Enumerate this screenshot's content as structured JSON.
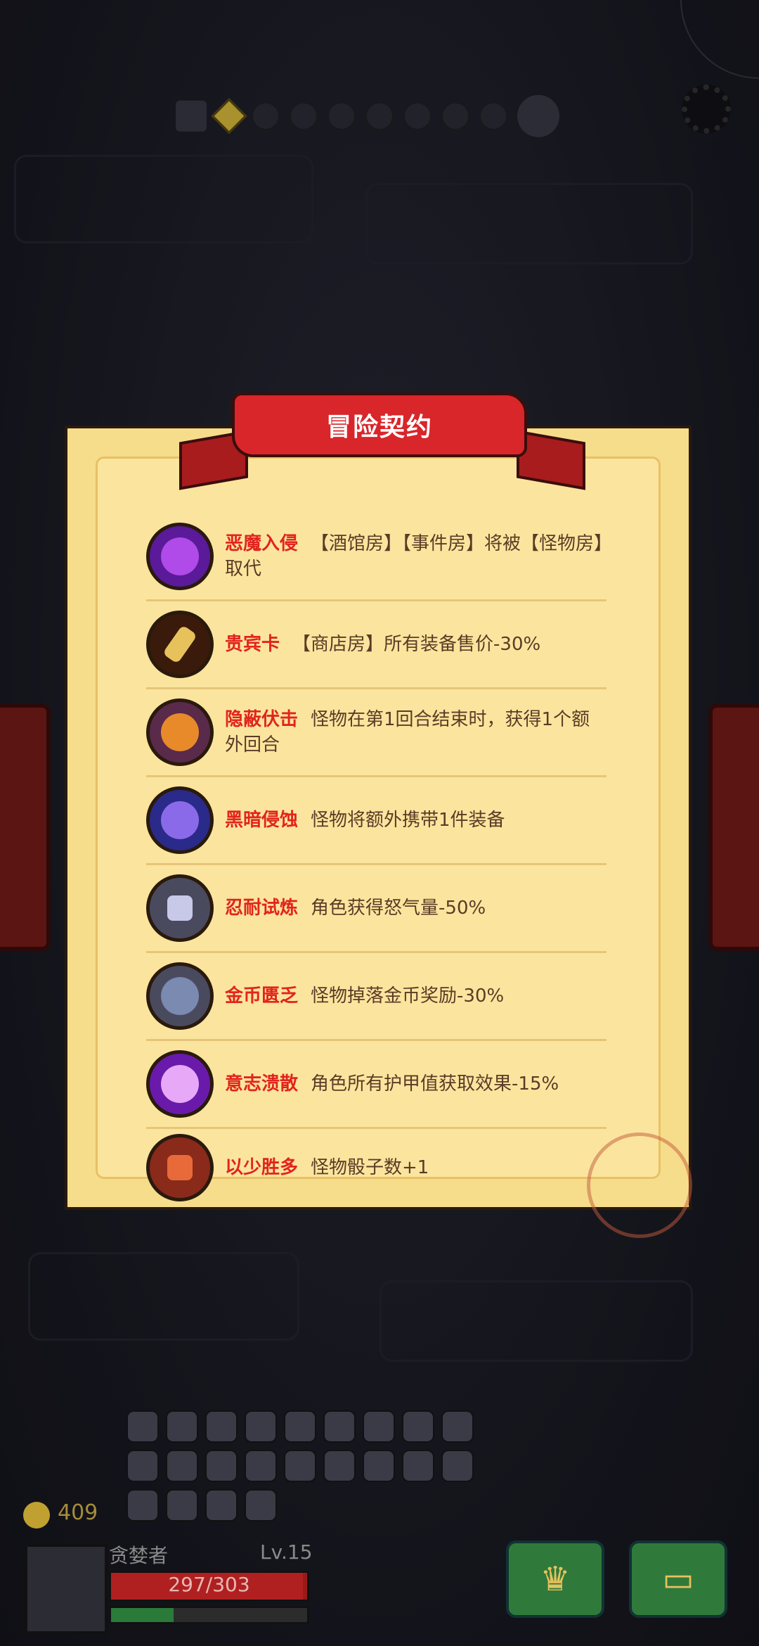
{
  "header": {
    "progress_steps": 9,
    "current_step": 1
  },
  "modal": {
    "title": "冒险契约",
    "contracts": [
      {
        "name": "恶魔入侵",
        "desc": "【酒馆房】【事件房】将被【怪物房】取代",
        "icon": "demon-icon",
        "color": "#7b2ed4"
      },
      {
        "name": "贵宾卡",
        "desc": "【商店房】所有装备售价-30%",
        "icon": "vip-card-icon",
        "color": "#3a1a0a"
      },
      {
        "name": "隐蔽伏击",
        "desc": "怪物在第1回合结束时，获得1个额外回合",
        "icon": "ambush-icon",
        "color": "#d87b1a"
      },
      {
        "name": "黑暗侵蚀",
        "desc": "怪物将额外携带1件装备",
        "icon": "dark-potion-icon",
        "color": "#4a3ad0"
      },
      {
        "name": "忍耐试炼",
        "desc": "角色获得怒气量-50%",
        "icon": "fist-icon",
        "color": "#5a5a72"
      },
      {
        "name": "金币匮乏",
        "desc": "怪物掉落金币奖励-30%",
        "icon": "coin-shield-icon",
        "color": "#5a5a72"
      },
      {
        "name": "意志溃散",
        "desc": "角色所有护甲值获取效果-15%",
        "icon": "broken-shield-icon",
        "color": "#8a2ad0"
      },
      {
        "name": "以少胜多",
        "desc": "怪物骰子数+1",
        "icon": "dice-icon",
        "color": "#c04a2a"
      }
    ]
  },
  "player": {
    "coins": "409",
    "name": "贪婪者",
    "level": "Lv.15",
    "hp": "297/303",
    "hp_fraction": 0.98,
    "exp_fraction": 0.32
  },
  "inventory_count": 22
}
